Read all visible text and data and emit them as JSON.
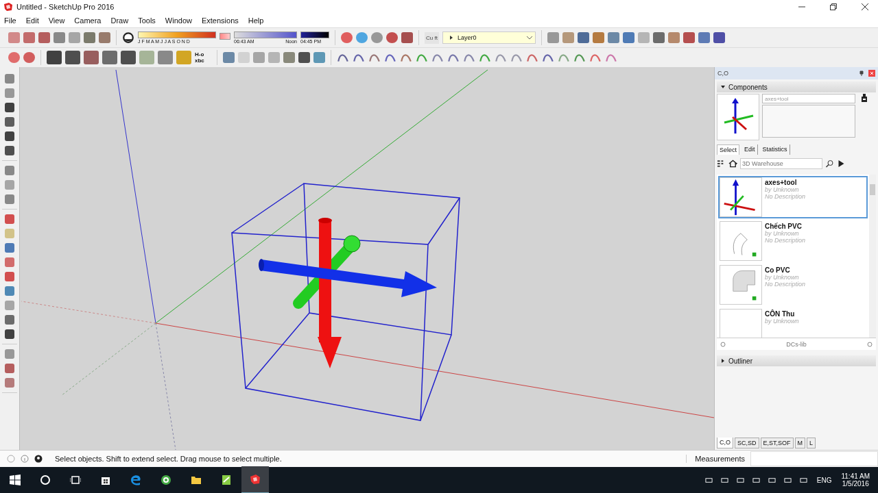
{
  "window": {
    "title": "Untitled - SketchUp Pro 2016"
  },
  "menu": [
    "File",
    "Edit",
    "View",
    "Camera",
    "Draw",
    "Tools",
    "Window",
    "Extensions",
    "Help"
  ],
  "toolbar": {
    "months": "J F M A M J J A S O N D",
    "time_start": "06:43 AM",
    "time_mid": "Noon",
    "time_end": "04:45 PM",
    "units": "Cu ft",
    "layer": "Layer0",
    "tool_label": "H-o xbc"
  },
  "tray": {
    "title": "C,O",
    "components": {
      "title": "Components",
      "expanded": true,
      "name_value": "axes+tool",
      "tabs": [
        {
          "label": "Select",
          "selected": true
        },
        {
          "label": "Edit",
          "selected": false
        },
        {
          "label": "Statistics",
          "selected": false
        }
      ],
      "search": {
        "placeholder": "3D Warehouse"
      },
      "items": [
        {
          "name": "axes+tool",
          "author": "by Unknown",
          "description": "No Description",
          "kind": "axes",
          "selected": true
        },
        {
          "name": "Chếch PVC",
          "author": "by Unknown",
          "description": "No Description",
          "kind": "bend",
          "selected": false
        },
        {
          "name": "Co PVC",
          "author": "by Unknown",
          "description": "No Description",
          "kind": "elbow",
          "selected": false
        },
        {
          "name": "CÔN Thu",
          "author": "by Unknown",
          "kind": "blank",
          "selected": false
        }
      ],
      "library": "DCs-lib"
    },
    "outliner": {
      "title": "Outliner",
      "expanded": false
    },
    "bottom_tabs": [
      {
        "label": "C,O",
        "selected": true
      },
      {
        "label": "SC,SD",
        "selected": false
      },
      {
        "label": "E,ST,SOF",
        "selected": false
      },
      {
        "label": "M",
        "selected": false
      },
      {
        "label": "L",
        "selected": false
      }
    ]
  },
  "status_bar": {
    "message": "Select objects. Shift to extend select. Drag mouse to select multiple.",
    "measurements_label": "Measurements"
  },
  "taskbar": {
    "language": "ENG",
    "time": "11:41 AM",
    "date": "1/5/2016"
  }
}
